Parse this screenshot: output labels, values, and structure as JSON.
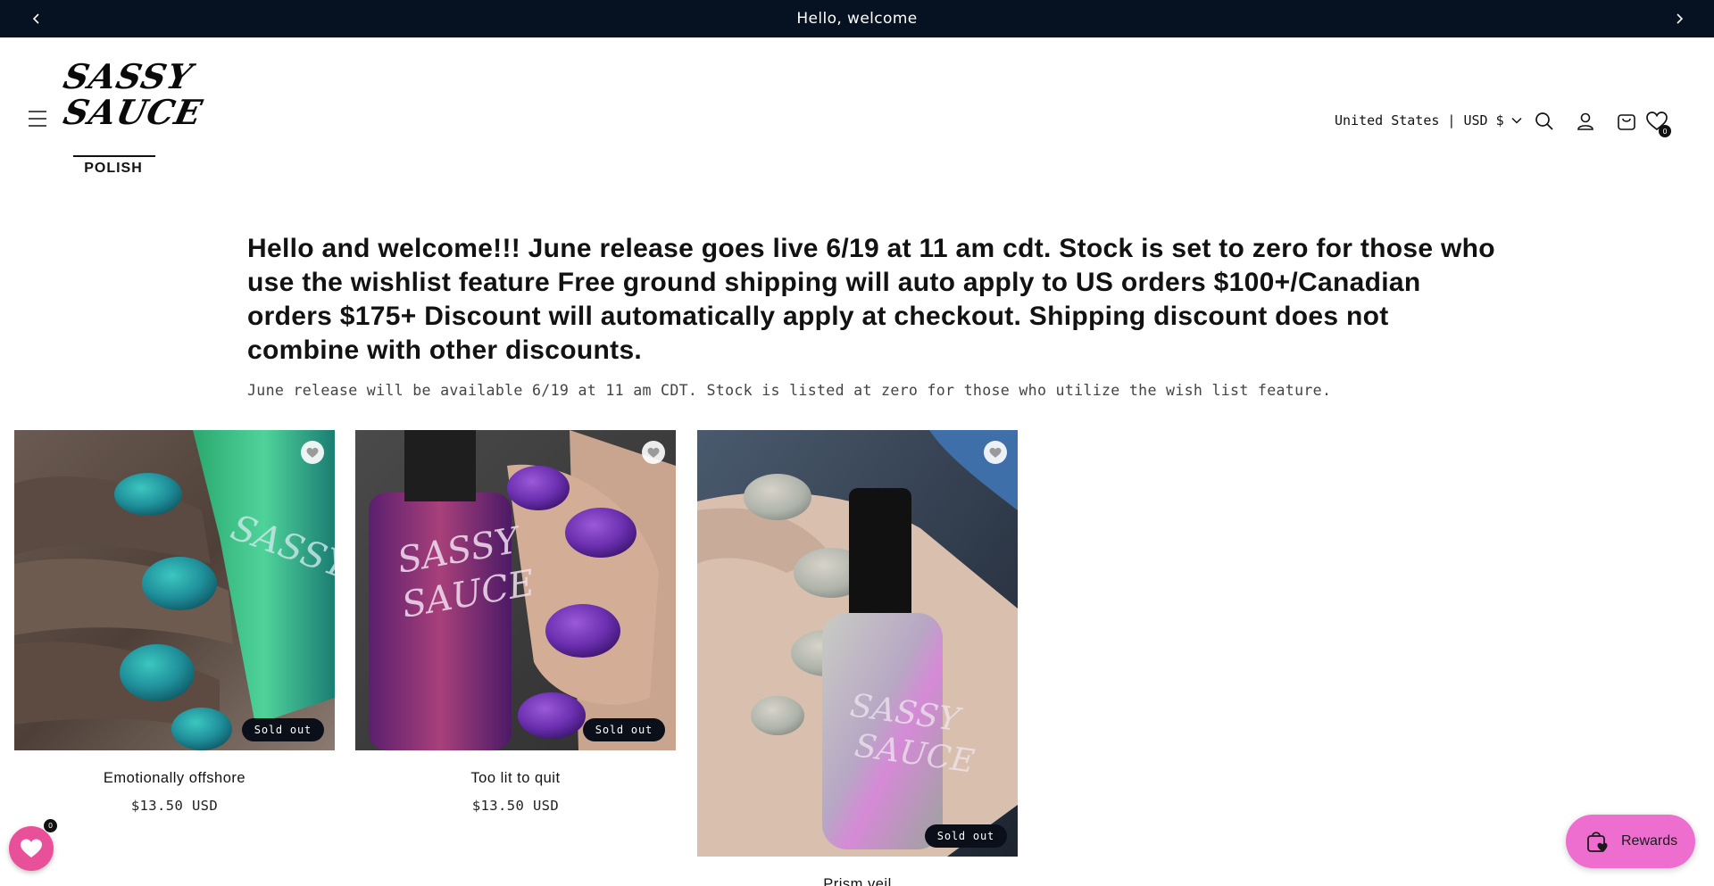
{
  "announcement": {
    "text": "Hello, welcome"
  },
  "header": {
    "logo": {
      "line1": "SASSY",
      "line2": "SAUCE",
      "line3": "POLISH"
    },
    "localization": "United States | USD $",
    "wishlist_count": "0"
  },
  "intro": {
    "title": "Hello and welcome!!! June release goes live 6/19 at 11 am cdt. Stock is set to zero for those who use the wishlist feature Free ground shipping will auto apply to US orders $100+/Canadian orders $175+ Discount will automatically apply at checkout. Shipping discount does not combine with other discounts.",
    "subtitle": "June release will be available 6/19 at 11 am CDT. Stock is listed at zero for those who utilize the wish list feature."
  },
  "products": [
    {
      "title": "Emotionally offshore",
      "price": "$13.50 USD",
      "badge": "Sold out",
      "polish_color": "#1f8f9a"
    },
    {
      "title": "Too lit to quit",
      "price": "$13.50 USD",
      "badge": "Sold out",
      "polish_color": "#6b2fb0"
    },
    {
      "title": "Prism veil",
      "price": "",
      "badge": "Sold out",
      "polish_color": "#b9bdb6"
    }
  ],
  "widgets": {
    "wishlist_count": "0",
    "rewards_label": "Rewards"
  },
  "colors": {
    "announcement_bg": "#061222",
    "badge_bg": "#0b0f1a",
    "wishlist_pink": "#e9509a",
    "rewards_pink": "#ee6ed0"
  }
}
